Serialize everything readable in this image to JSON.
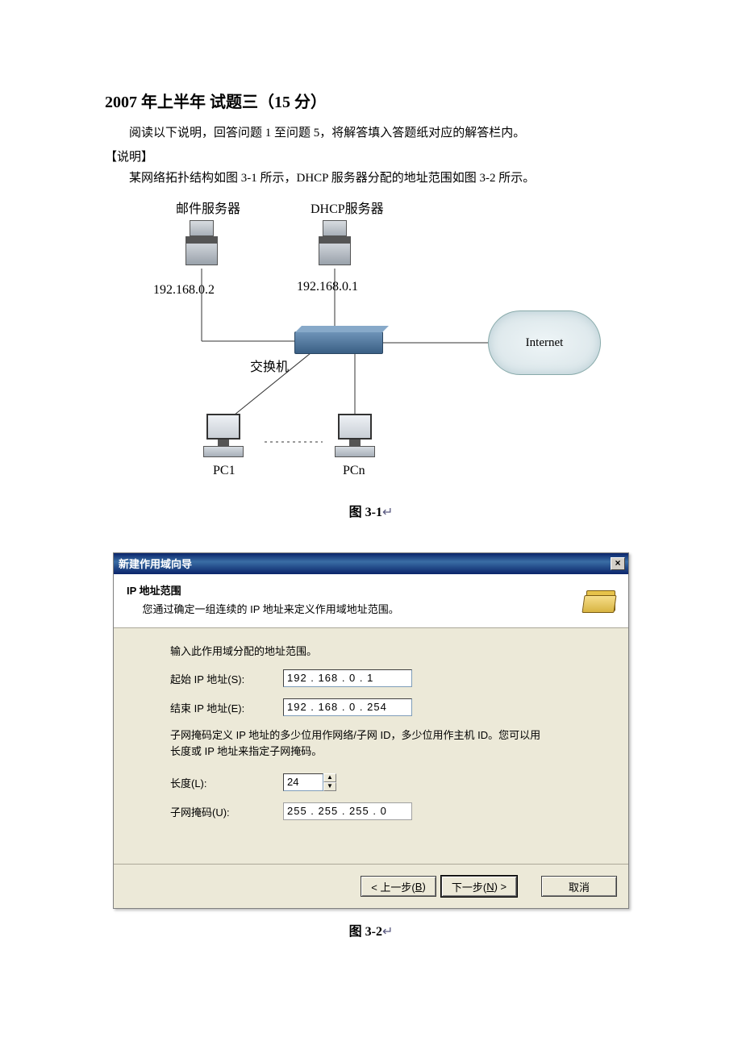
{
  "doc": {
    "title": "2007 年上半年  试题三（15 分）",
    "intro": "阅读以下说明，回答问题 1 至问题 5，将解答填入答题纸对应的解答栏内。",
    "section_label": "【说明】",
    "body": "某网络拓扑结构如图 3-1 所示，DHCP 服务器分配的地址范围如图 3-2 所示。"
  },
  "diagram": {
    "mail_server_label": "邮件服务器",
    "dhcp_server_label": "DHCP服务器",
    "mail_ip": "192.168.0.2",
    "dhcp_ip": "192.168.0.1",
    "switch_label": "交换机",
    "internet_label": "Internet",
    "pc1_label": "PC1",
    "pcn_label": "PCn",
    "caption": "图 3-1",
    "caption_suffix": "↵"
  },
  "dialog": {
    "titlebar": "新建作用域向导",
    "close_glyph": "×",
    "header_title": "IP 地址范围",
    "header_desc": "您通过确定一组连续的 IP 地址来定义作用域地址范围。",
    "instruction": "输入此作用域分配的地址范围。",
    "start_label": "起始 IP 地址(S):",
    "start_value": "192 . 168 .  0  .  1",
    "end_label": "结束 IP 地址(E):",
    "end_value": "192 . 168 .  0  . 254",
    "mask_explain": "子网掩码定义 IP 地址的多少位用作网络/子网 ID，多少位用作主机 ID。您可以用长度或 IP 地址来指定子网掩码。",
    "length_label": "长度(L):",
    "length_value": "24",
    "mask_label": "子网掩码(U):",
    "mask_value": "255 . 255 . 255 .  0",
    "back_prefix": "< 上一步(",
    "back_key": "B",
    "back_suffix": ")",
    "next_prefix": "下一步(",
    "next_key": "N",
    "next_suffix": ") >",
    "cancel": "取消",
    "caption": "图 3-2",
    "caption_suffix": "↵"
  }
}
